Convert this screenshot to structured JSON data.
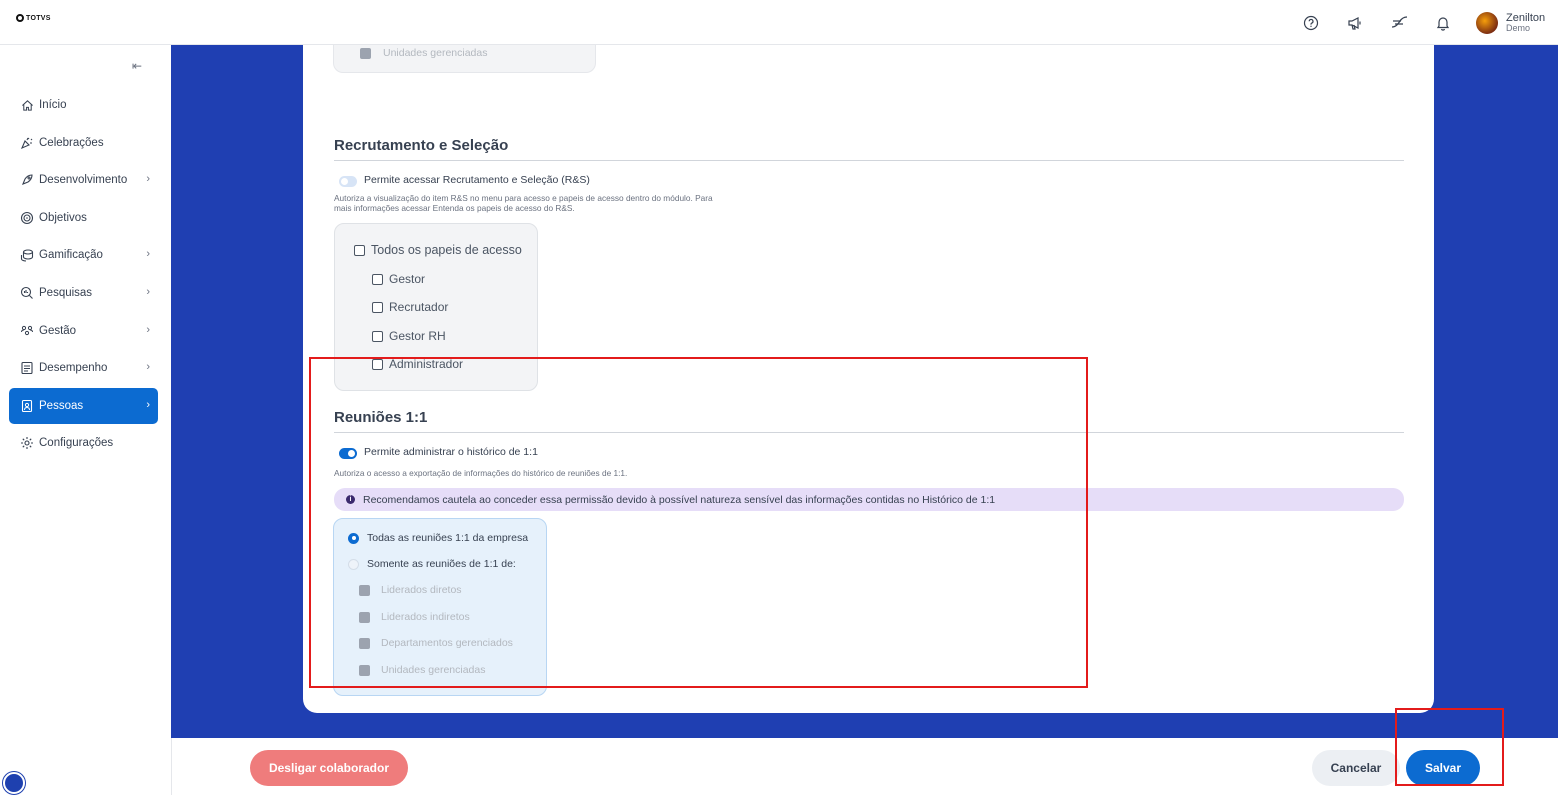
{
  "app": {
    "logo_text": "TOTVS"
  },
  "header": {
    "icons": [
      "help-icon",
      "megaphone-icon",
      "feedback-icon",
      "bell-icon"
    ],
    "user": {
      "name": "Zenilton",
      "subtitle": "Demo"
    }
  },
  "sidebar": {
    "collapse_icon": "collapse-left-icon",
    "items": [
      {
        "label": "Início",
        "icon": "home-icon",
        "has_children": false
      },
      {
        "label": "Celebrações",
        "icon": "celebration-icon",
        "has_children": false
      },
      {
        "label": "Desenvolvimento",
        "icon": "rocket-icon",
        "has_children": true
      },
      {
        "label": "Objetivos",
        "icon": "target-icon",
        "has_children": false
      },
      {
        "label": "Gamificação",
        "icon": "coins-icon",
        "has_children": true
      },
      {
        "label": "Pesquisas",
        "icon": "survey-icon",
        "has_children": true
      },
      {
        "label": "Gestão",
        "icon": "people-icon",
        "has_children": true
      },
      {
        "label": "Desempenho",
        "icon": "performance-icon",
        "has_children": true
      },
      {
        "label": "Pessoas",
        "icon": "person-badge-icon",
        "has_children": true,
        "active": true
      },
      {
        "label": "Configurações",
        "icon": "gear-icon",
        "has_children": false
      }
    ]
  },
  "previous_section": {
    "last_item": "Unidades gerenciadas"
  },
  "recruitment": {
    "title": "Recrutamento e Seleção",
    "toggle_label": "Permite acessar Recrutamento e Seleção (R&S)",
    "toggle_on": false,
    "description_line1": "Autoriza a visualização do item R&S no menu para acesso e papeis de acesso dentro do módulo. Para",
    "description_line2": "mais informações acessar Entenda os papeis de acesso do R&S.",
    "all_roles_label": "Todos os papeis de acesso",
    "roles": [
      "Gestor",
      "Recrutador",
      "Gestor RH",
      "Administrador"
    ]
  },
  "meetings": {
    "title": "Reuniões 1:1",
    "toggle_label": "Permite administrar o histórico de 1:1",
    "toggle_on": true,
    "description": "Autoriza o acesso a exportação de informações do histórico de reuniões de 1:1.",
    "alert": "Recomendamos cautela ao conceder essa permissão devido à possível natureza sensível das informações contidas no Histórico de 1:1",
    "option_all": "Todas as reuniões 1:1 da empresa",
    "option_only": "Somente as reuniões de 1:1 de:",
    "selected_option": "Todas as reuniões 1:1 da empresa",
    "sub_options": [
      "Liderados diretos",
      "Liderados indiretos",
      "Departamentos gerenciados",
      "Unidades gerenciadas"
    ]
  },
  "footer": {
    "dismiss_label": "Desligar colaborador",
    "cancel_label": "Cancelar",
    "save_label": "Salvar"
  },
  "colors": {
    "primary": "#0c6bd1",
    "main_background": "#1f3fb2",
    "danger": "#ef7c7c",
    "highlight": "#e31b1b",
    "alert_background": "#e6ddf8"
  }
}
